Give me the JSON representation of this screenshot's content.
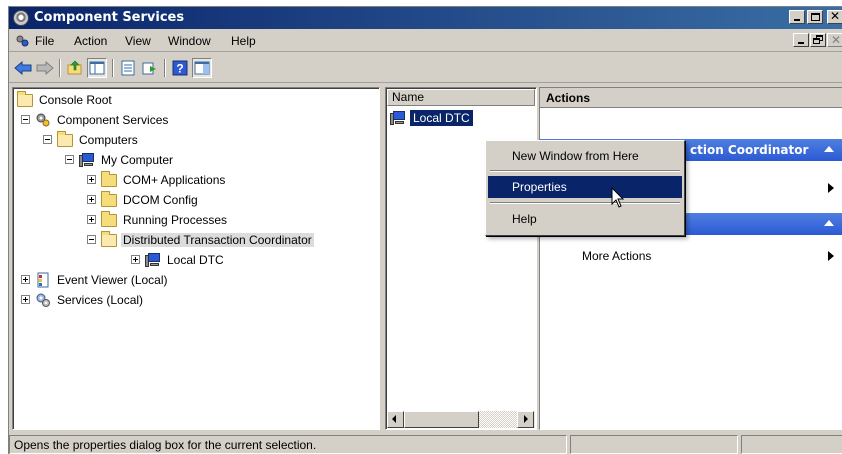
{
  "window": {
    "title": "Component Services"
  },
  "menubar": {
    "items": [
      "File",
      "Action",
      "View",
      "Window",
      "Help"
    ]
  },
  "toolbar": {
    "buttons": [
      "back-arrow-icon",
      "forward-arrow-icon",
      "up-folder-icon",
      "show-tree-icon",
      "properties-icon",
      "export-icon",
      "help-icon",
      "show-action-pane-icon"
    ]
  },
  "tree": {
    "items": [
      {
        "label": "Console Root",
        "icon": "folder-open-icon"
      },
      {
        "label": "Component Services",
        "icon": "component-services-icon"
      },
      {
        "label": "Computers",
        "icon": "folder-open-icon"
      },
      {
        "label": "My Computer",
        "icon": "computer-icon"
      },
      {
        "label": "COM+ Applications",
        "icon": "folder-icon"
      },
      {
        "label": "DCOM Config",
        "icon": "folder-icon"
      },
      {
        "label": "Running Processes",
        "icon": "folder-icon"
      },
      {
        "label": "Distributed Transaction Coordinator",
        "icon": "folder-open-icon",
        "selected": true
      },
      {
        "label": "Local DTC",
        "icon": "computer-icon"
      },
      {
        "label": "Event Viewer (Local)",
        "icon": "event-viewer-icon"
      },
      {
        "label": "Services (Local)",
        "icon": "services-icon"
      }
    ]
  },
  "list": {
    "column_header": "Name",
    "items": [
      {
        "label": "Local DTC"
      }
    ]
  },
  "actions": {
    "header": "Actions",
    "section1_title": "ction Coordinator",
    "section2_row_more": "More Actions"
  },
  "context_menu": {
    "items": [
      "New Window from Here",
      "Properties",
      "Help"
    ],
    "highlighted": "Properties"
  },
  "statusbar": {
    "text": "Opens the properties dialog box for the current selection."
  },
  "colors": {
    "title_bar": "#0a246a",
    "selection": "#0a246a",
    "action_section": "#2b5ad4",
    "chrome": "#d4d0c8"
  }
}
